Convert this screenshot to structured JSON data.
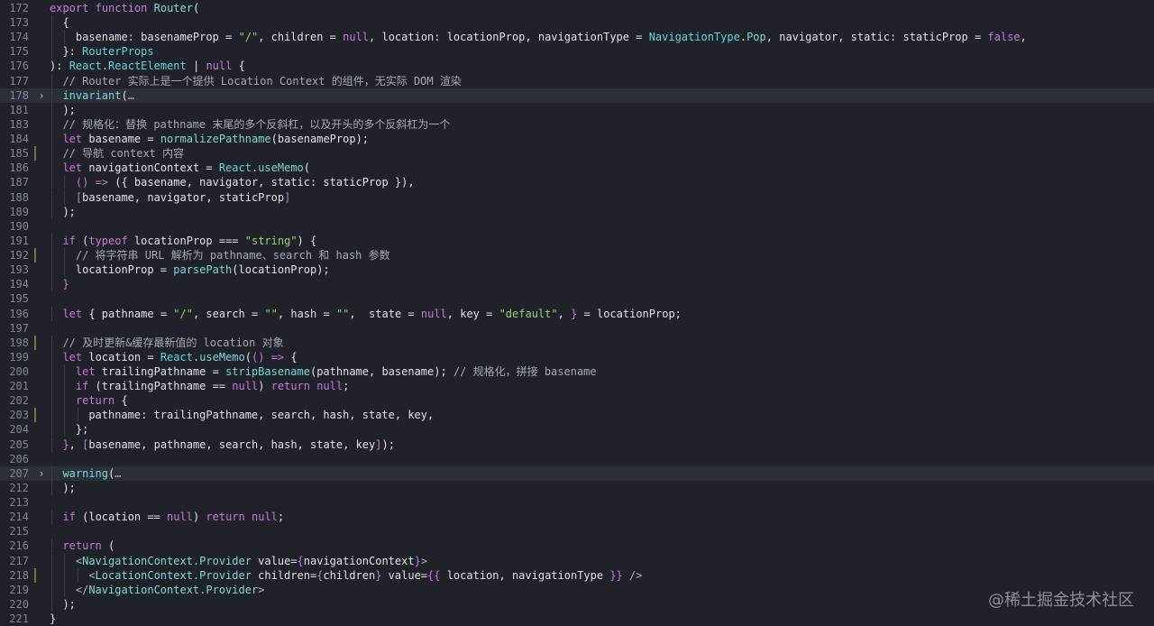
{
  "watermark": "@稀土掘金技术社区",
  "lines": [
    {
      "num": "172",
      "tokens": [
        [
          "keyword",
          "export"
        ],
        [
          "plain",
          " "
        ],
        [
          "keyword",
          "function"
        ],
        [
          "plain",
          " "
        ],
        [
          "func",
          "Router"
        ],
        [
          "plain",
          "("
        ]
      ]
    },
    {
      "num": "173",
      "indent": 2,
      "tokens": [
        [
          "plain",
          "{"
        ]
      ]
    },
    {
      "num": "174",
      "indent": 4,
      "tokens": [
        [
          "plain",
          "basename: basenameProp = "
        ],
        [
          "string",
          "\"/\""
        ],
        [
          "plain",
          ", children = "
        ],
        [
          "bool",
          "null"
        ],
        [
          "plain",
          ", location: locationProp, navigationType = "
        ],
        [
          "type",
          "NavigationType"
        ],
        [
          "plain",
          "."
        ],
        [
          "func",
          "Pop"
        ],
        [
          "plain",
          ", navigator, static: staticProp = "
        ],
        [
          "bool",
          "false"
        ],
        [
          "plain",
          ","
        ]
      ]
    },
    {
      "num": "175",
      "indent": 2,
      "tokens": [
        [
          "plain",
          "}: "
        ],
        [
          "type",
          "RouterProps"
        ]
      ]
    },
    {
      "num": "176",
      "tokens": [
        [
          "plain",
          "): "
        ],
        [
          "type",
          "React"
        ],
        [
          "plain",
          "."
        ],
        [
          "type",
          "ReactElement"
        ],
        [
          "plain",
          " | "
        ],
        [
          "bool",
          "null"
        ],
        [
          "plain",
          " {"
        ]
      ]
    },
    {
      "num": "177",
      "indent": 2,
      "tokens": [
        [
          "comment",
          "// Router 实际上是一个提供 Location Context 的组件，无实际 DOM 渲染"
        ]
      ]
    },
    {
      "num": "178",
      "indent": 2,
      "fold": "›",
      "highlight": true,
      "tokens": [
        [
          "func",
          "invariant"
        ],
        [
          "plain",
          "("
        ],
        [
          "muted",
          "…"
        ]
      ]
    },
    {
      "num": "181",
      "indent": 2,
      "tokens": [
        [
          "plain",
          ");"
        ]
      ]
    },
    {
      "num": "183",
      "indent": 2,
      "tokens": [
        [
          "comment",
          "// 规格化：替换 pathname 末尾的多个反斜杠，以及开头的多个反斜杠为一个"
        ]
      ]
    },
    {
      "num": "184",
      "indent": 2,
      "tokens": [
        [
          "keyword",
          "let"
        ],
        [
          "plain",
          " basename = "
        ],
        [
          "func",
          "normalizePathname"
        ],
        [
          "plain",
          "(basenameProp);"
        ]
      ]
    },
    {
      "num": "185",
      "indent": 2,
      "mark": true,
      "tokens": [
        [
          "comment",
          "// 导航 context 内容"
        ]
      ]
    },
    {
      "num": "186",
      "indent": 2,
      "tokens": [
        [
          "keyword",
          "let"
        ],
        [
          "plain",
          " navigationContext = "
        ],
        [
          "type",
          "React"
        ],
        [
          "plain",
          "."
        ],
        [
          "func",
          "useMemo"
        ],
        [
          "plain",
          "("
        ]
      ]
    },
    {
      "num": "187",
      "indent": 4,
      "tokens": [
        [
          "keyword",
          "()"
        ],
        [
          "plain",
          " "
        ],
        [
          "keyword",
          "=>"
        ],
        [
          "plain",
          " ({ basename, navigator, static: staticProp }),"
        ]
      ]
    },
    {
      "num": "188",
      "indent": 4,
      "tokens": [
        [
          "keyword",
          "["
        ],
        [
          "plain",
          "basename, navigator, staticProp"
        ],
        [
          "keyword",
          "]"
        ]
      ]
    },
    {
      "num": "189",
      "indent": 2,
      "tokens": [
        [
          "plain",
          ");"
        ]
      ]
    },
    {
      "num": "190",
      "tokens": []
    },
    {
      "num": "191",
      "indent": 2,
      "tokens": [
        [
          "keyword",
          "if"
        ],
        [
          "plain",
          " ("
        ],
        [
          "keyword",
          "typeof"
        ],
        [
          "plain",
          " locationProp === "
        ],
        [
          "string",
          "\"string\""
        ],
        [
          "plain",
          ") {"
        ]
      ]
    },
    {
      "num": "192",
      "indent": 4,
      "mark": true,
      "tokens": [
        [
          "comment",
          "// 将字符串 URL 解析为 pathname、search 和 hash 参数"
        ]
      ]
    },
    {
      "num": "193",
      "indent": 4,
      "tokens": [
        [
          "plain",
          "locationProp = "
        ],
        [
          "func",
          "parsePath"
        ],
        [
          "plain",
          "(locationProp);"
        ]
      ]
    },
    {
      "num": "194",
      "indent": 2,
      "tokens": [
        [
          "keyword",
          "}"
        ]
      ]
    },
    {
      "num": "195",
      "tokens": []
    },
    {
      "num": "196",
      "indent": 2,
      "tokens": [
        [
          "keyword",
          "let"
        ],
        [
          "plain",
          " { pathname = "
        ],
        [
          "string",
          "\"/\""
        ],
        [
          "plain",
          ", search = "
        ],
        [
          "string",
          "\"\""
        ],
        [
          "plain",
          ", hash = "
        ],
        [
          "string",
          "\"\""
        ],
        [
          "plain",
          ",  state = "
        ],
        [
          "bool",
          "null"
        ],
        [
          "plain",
          ", key = "
        ],
        [
          "string",
          "\"default\""
        ],
        [
          "plain",
          ", "
        ],
        [
          "keyword",
          "}"
        ],
        [
          "plain",
          " = locationProp;"
        ]
      ]
    },
    {
      "num": "197",
      "tokens": []
    },
    {
      "num": "198",
      "indent": 2,
      "mark": true,
      "tokens": [
        [
          "comment",
          "// 及时更新&缓存最新值的 location 对象"
        ]
      ]
    },
    {
      "num": "199",
      "indent": 2,
      "tokens": [
        [
          "keyword",
          "let"
        ],
        [
          "plain",
          " location = "
        ],
        [
          "type",
          "React"
        ],
        [
          "plain",
          "."
        ],
        [
          "func",
          "useMemo"
        ],
        [
          "plain",
          "("
        ],
        [
          "keyword",
          "()"
        ],
        [
          "plain",
          " "
        ],
        [
          "keyword",
          "=>"
        ],
        [
          "plain",
          " {"
        ]
      ]
    },
    {
      "num": "200",
      "indent": 4,
      "tokens": [
        [
          "keyword",
          "let"
        ],
        [
          "plain",
          " trailingPathname = "
        ],
        [
          "func",
          "stripBasename"
        ],
        [
          "plain",
          "(pathname, basename); "
        ],
        [
          "comment",
          "// 规格化，拼接 basename"
        ]
      ]
    },
    {
      "num": "201",
      "indent": 4,
      "tokens": [
        [
          "keyword",
          "if"
        ],
        [
          "plain",
          " (trailingPathname == "
        ],
        [
          "bool",
          "null"
        ],
        [
          "plain",
          ") "
        ],
        [
          "keyword",
          "return"
        ],
        [
          "plain",
          " "
        ],
        [
          "bool",
          "null"
        ],
        [
          "plain",
          ";"
        ]
      ]
    },
    {
      "num": "202",
      "indent": 4,
      "tokens": [
        [
          "keyword",
          "return"
        ],
        [
          "plain",
          " {"
        ]
      ]
    },
    {
      "num": "203",
      "indent": 6,
      "mark": true,
      "tokens": [
        [
          "plain",
          "pathname: trailingPathname, search, hash, state, key,"
        ]
      ]
    },
    {
      "num": "204",
      "indent": 4,
      "tokens": [
        [
          "plain",
          "};"
        ]
      ]
    },
    {
      "num": "205",
      "indent": 2,
      "tokens": [
        [
          "keyword",
          "}"
        ],
        [
          "plain",
          ", "
        ],
        [
          "keyword",
          "["
        ],
        [
          "plain",
          "basename, pathname, search, hash, state, key"
        ],
        [
          "keyword",
          "]"
        ],
        [
          "plain",
          ");"
        ]
      ]
    },
    {
      "num": "206",
      "tokens": []
    },
    {
      "num": "207",
      "indent": 2,
      "fold": "›",
      "highlight": true,
      "tokens": [
        [
          "func",
          "warning"
        ],
        [
          "plain",
          "("
        ],
        [
          "muted",
          "…"
        ]
      ]
    },
    {
      "num": "212",
      "indent": 2,
      "tokens": [
        [
          "plain",
          ");"
        ]
      ]
    },
    {
      "num": "213",
      "tokens": []
    },
    {
      "num": "214",
      "indent": 2,
      "tokens": [
        [
          "keyword",
          "if"
        ],
        [
          "plain",
          " (location == "
        ],
        [
          "bool",
          "null"
        ],
        [
          "plain",
          ") "
        ],
        [
          "keyword",
          "return"
        ],
        [
          "plain",
          " "
        ],
        [
          "bool",
          "null"
        ],
        [
          "plain",
          ";"
        ]
      ]
    },
    {
      "num": "215",
      "tokens": []
    },
    {
      "num": "216",
      "indent": 2,
      "tokens": [
        [
          "keyword",
          "return"
        ],
        [
          "plain",
          " ("
        ]
      ]
    },
    {
      "num": "217",
      "indent": 4,
      "tokens": [
        [
          "muted",
          "<"
        ],
        [
          "tag",
          "NavigationContext.Provider"
        ],
        [
          "plain",
          " value="
        ],
        [
          "keyword",
          "{"
        ],
        [
          "plain",
          "navigationContext"
        ],
        [
          "keyword",
          "}"
        ],
        [
          "muted",
          ">"
        ]
      ]
    },
    {
      "num": "218",
      "indent": 6,
      "mark": true,
      "tokens": [
        [
          "muted",
          "<"
        ],
        [
          "tag",
          "LocationContext.Provider"
        ],
        [
          "plain",
          " children="
        ],
        [
          "keyword",
          "{"
        ],
        [
          "plain",
          "children"
        ],
        [
          "keyword",
          "}"
        ],
        [
          "plain",
          " value="
        ],
        [
          "keyword",
          "{{"
        ],
        [
          "plain",
          " location, navigationType "
        ],
        [
          "keyword",
          "}}"
        ],
        [
          "plain",
          " "
        ],
        [
          "muted",
          "/>"
        ]
      ]
    },
    {
      "num": "219",
      "indent": 4,
      "tokens": [
        [
          "muted",
          "</"
        ],
        [
          "tag",
          "NavigationContext.Provider"
        ],
        [
          "muted",
          ">"
        ]
      ]
    },
    {
      "num": "220",
      "indent": 2,
      "tokens": [
        [
          "plain",
          ");"
        ]
      ]
    },
    {
      "num": "221",
      "tokens": [
        [
          "plain",
          "}"
        ]
      ]
    }
  ]
}
